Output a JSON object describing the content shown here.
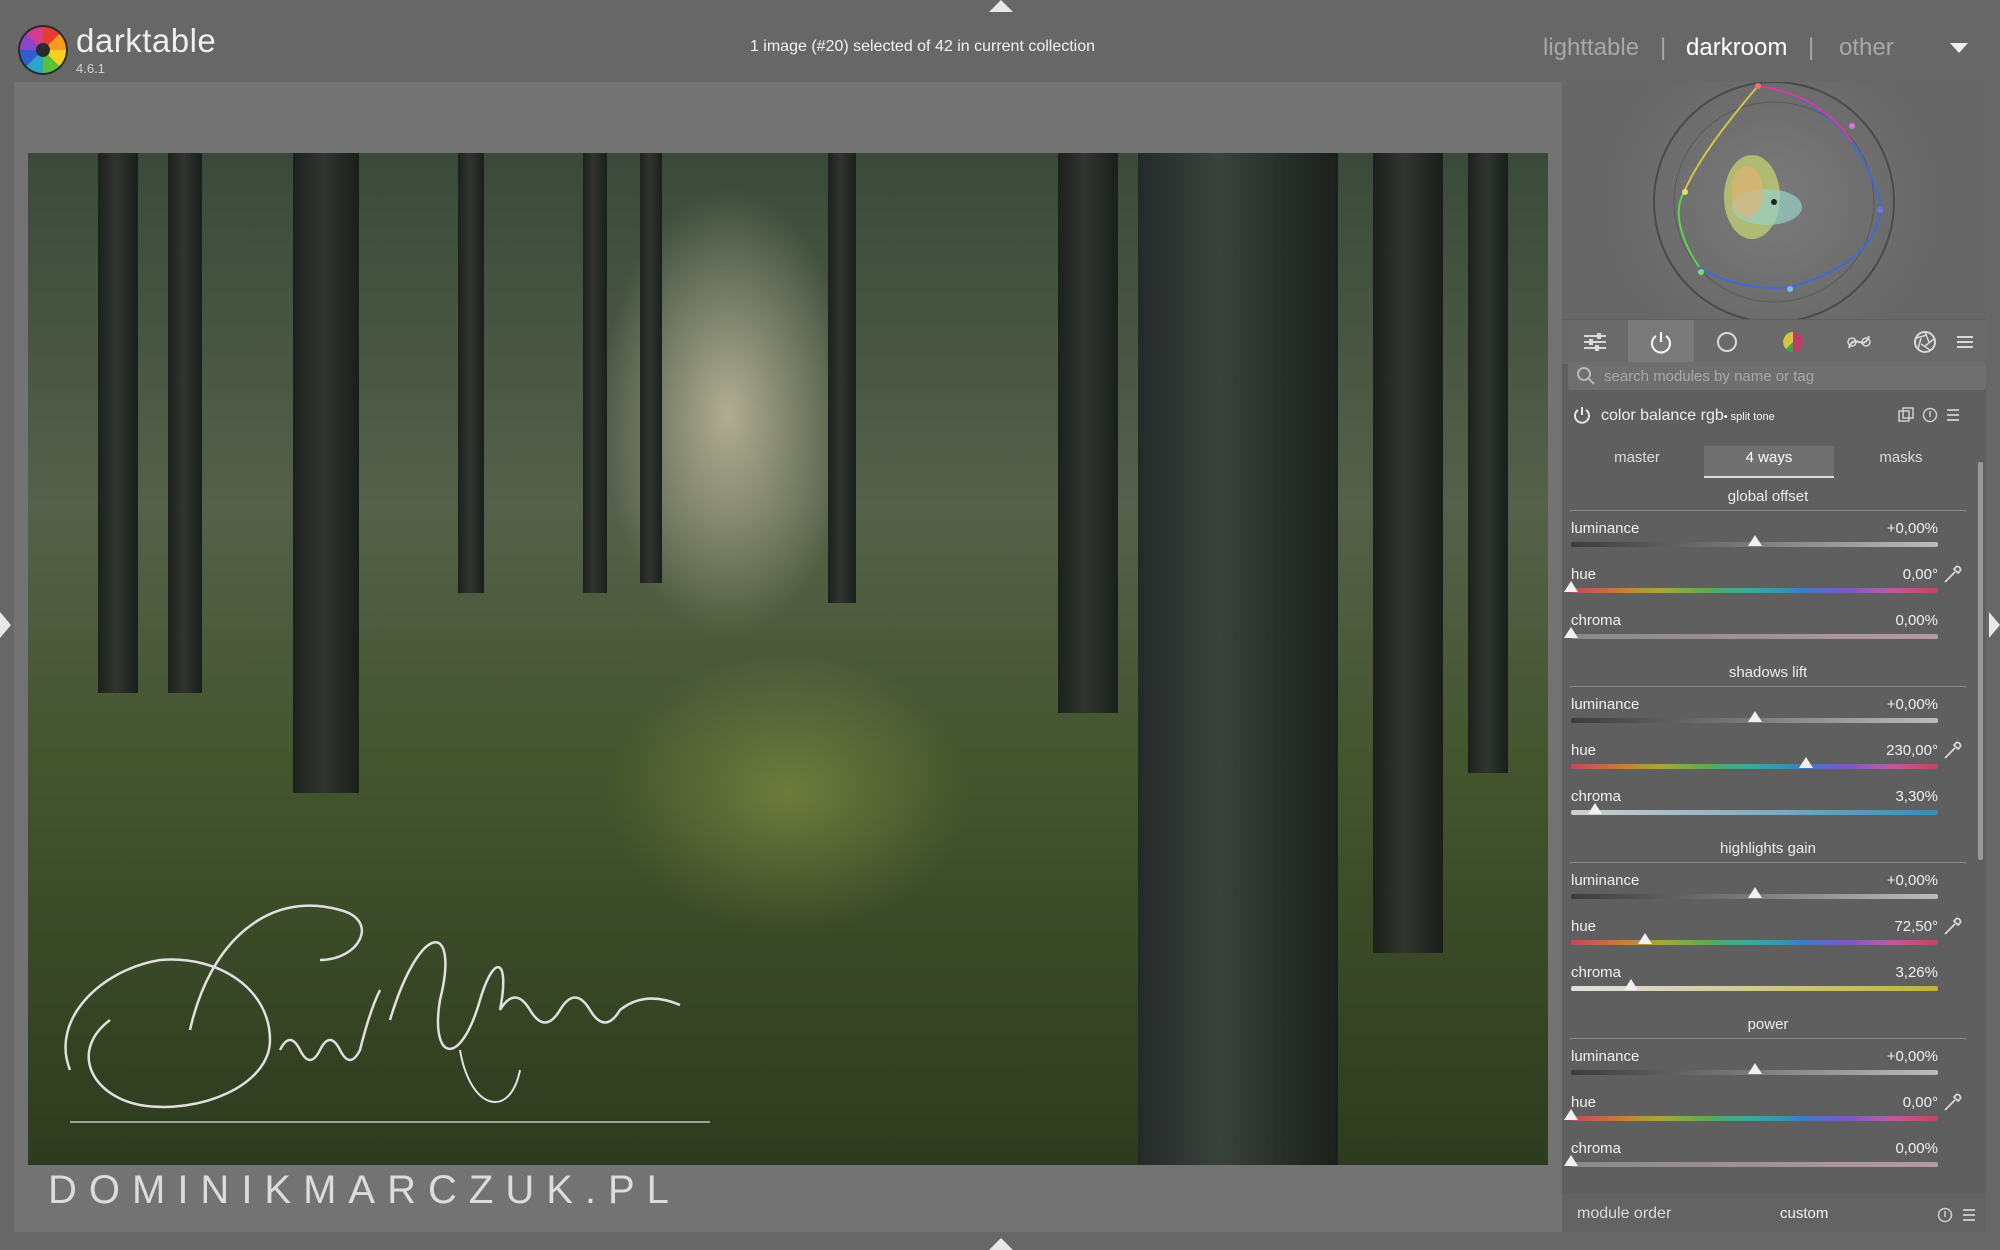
{
  "app": {
    "name": "darktable",
    "version": "4.6.1"
  },
  "header": {
    "status": "1 image (#20) selected of 42 in current collection",
    "views": [
      "lighttable",
      "darkroom",
      "other"
    ],
    "separator": "|",
    "active_view": "darkroom"
  },
  "image": {
    "watermark": "DOMINIKMARCZUK.PL",
    "signature_icon": "handwritten-signature"
  },
  "right_panel": {
    "scope_icon": "vectorscope",
    "toolbar_icons": [
      "sliders-icon",
      "power-icon",
      "circle-icon",
      "color-wheel-icon",
      "curve-icon",
      "aperture-icon",
      "menu-icon"
    ],
    "search_placeholder": "search modules by name or tag",
    "module": {
      "title": "color balance rgb",
      "preset": "• split tone",
      "tabs": [
        "master",
        "4 ways",
        "masks"
      ],
      "active_tab": "4 ways",
      "sections": [
        {
          "title": "global offset",
          "sliders": [
            {
              "label": "luminance",
              "value": "+0,00%",
              "position": 0.5
            },
            {
              "label": "hue",
              "value": "0,00°",
              "position": 0.0
            },
            {
              "label": "chroma",
              "value": "0,00%",
              "position": 0.0
            }
          ]
        },
        {
          "title": "shadows lift",
          "sliders": [
            {
              "label": "luminance",
              "value": "+0,00%",
              "position": 0.5
            },
            {
              "label": "hue",
              "value": "230,00°",
              "position": 0.639
            },
            {
              "label": "chroma",
              "value": "3,30%",
              "position": 0.066
            }
          ]
        },
        {
          "title": "highlights gain",
          "sliders": [
            {
              "label": "luminance",
              "value": "+0,00%",
              "position": 0.5
            },
            {
              "label": "hue",
              "value": "72,50°",
              "position": 0.201
            },
            {
              "label": "chroma",
              "value": "3,26%",
              "position": 0.163
            }
          ]
        },
        {
          "title": "power",
          "sliders": [
            {
              "label": "luminance",
              "value": "+0,00%",
              "position": 0.5
            },
            {
              "label": "hue",
              "value": "0,00°",
              "position": 0.0
            },
            {
              "label": "chroma",
              "value": "0,00%",
              "position": 0.0
            }
          ]
        }
      ]
    },
    "footer": {
      "label": "module order",
      "value": "custom"
    }
  },
  "colors": {
    "background": "#676767",
    "panel": "#5f5f5f",
    "text": "#e6e6e6",
    "inactive_tab": "#a8a8a8"
  }
}
